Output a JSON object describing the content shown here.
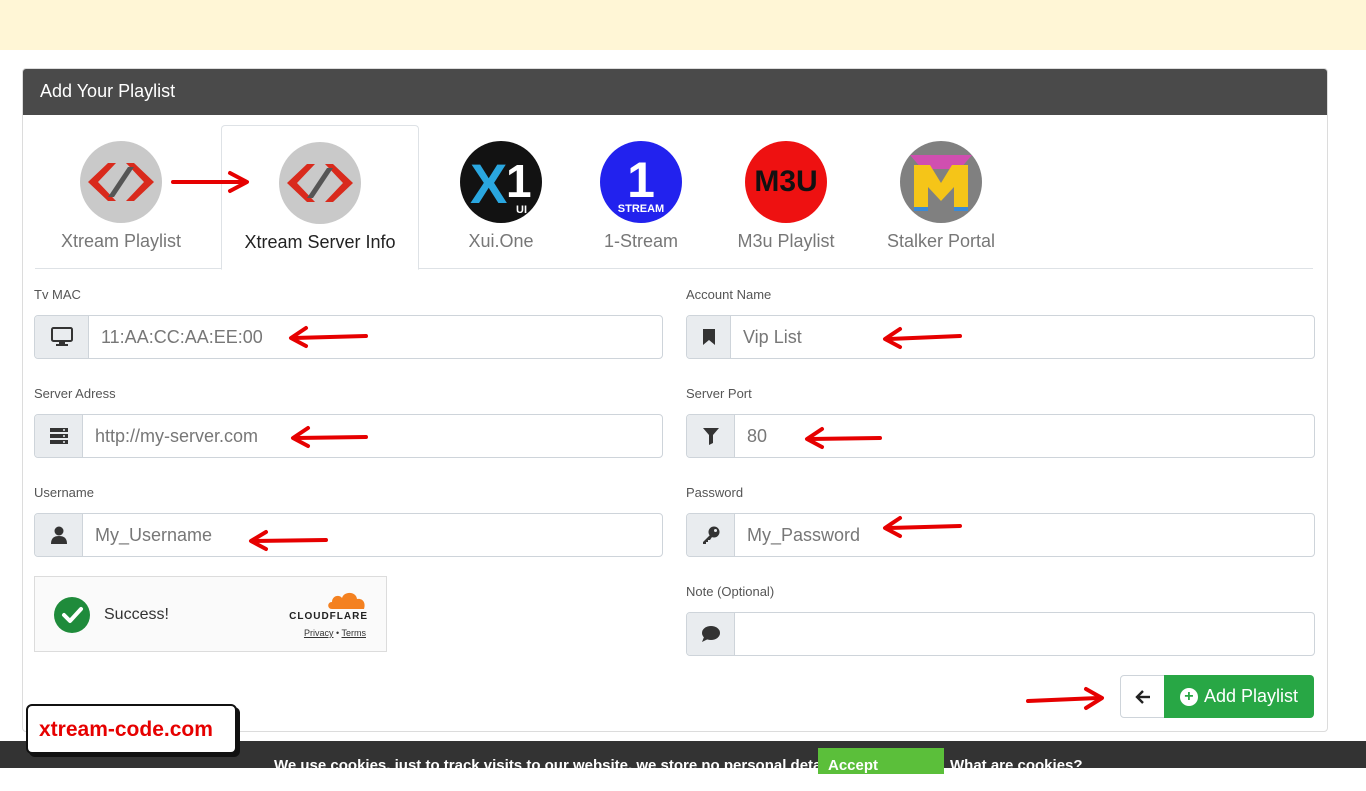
{
  "panel": {
    "title": "Add Your Playlist"
  },
  "tabs": [
    {
      "label": "Xtream Playlist",
      "icon": "xtream-logo"
    },
    {
      "label": "Xtream Server Info",
      "icon": "xtream-logo",
      "active": true
    },
    {
      "label": "Xui.One",
      "icon": "x1-logo",
      "logo_text": "X1",
      "logo_sub": "UI"
    },
    {
      "label": "1-Stream",
      "icon": "stream-logo",
      "logo_text": "1",
      "logo_sub": "STREAM"
    },
    {
      "label": "M3u Playlist",
      "icon": "m3u-logo",
      "logo_text": "M3U"
    },
    {
      "label": "Stalker Portal",
      "icon": "stalker-logo"
    }
  ],
  "form": {
    "tv_mac": {
      "label": "Tv MAC",
      "placeholder": "11:AA:CC:AA:EE:00",
      "icon": "monitor-icon"
    },
    "account_name": {
      "label": "Account Name",
      "placeholder": "Vip List",
      "icon": "bookmark-icon"
    },
    "server_address": {
      "label": "Server Adress",
      "placeholder": "http://my-server.com",
      "icon": "server-icon"
    },
    "server_port": {
      "label": "Server Port",
      "placeholder": "80",
      "icon": "filter-icon"
    },
    "username": {
      "label": "Username",
      "placeholder": "My_Username",
      "icon": "user-icon"
    },
    "password": {
      "label": "Password",
      "placeholder": "My_Password",
      "icon": "key-icon"
    },
    "note": {
      "label": "Note (Optional)",
      "placeholder": "",
      "icon": "comment-icon"
    }
  },
  "captcha": {
    "status": "Success!",
    "provider": "CLOUDFLARE",
    "privacy": "Privacy",
    "separator": "•",
    "terms": "Terms"
  },
  "actions": {
    "add_label": "Add Playlist",
    "back_icon": "arrow-left-icon",
    "add_icon": "plus-circle-icon"
  },
  "cookie_bar": {
    "text": "We use cookies, just to track visits to our website, we store no personal details.",
    "accept_label": "Accept Cookies",
    "more_label": "What are cookies?"
  },
  "watermark": {
    "text": "xtream-code.com"
  },
  "colors": {
    "header": "#4a4a4a",
    "accent_green": "#28a745",
    "annotation_red": "#e60000",
    "top_banner": "#fff6d6"
  }
}
